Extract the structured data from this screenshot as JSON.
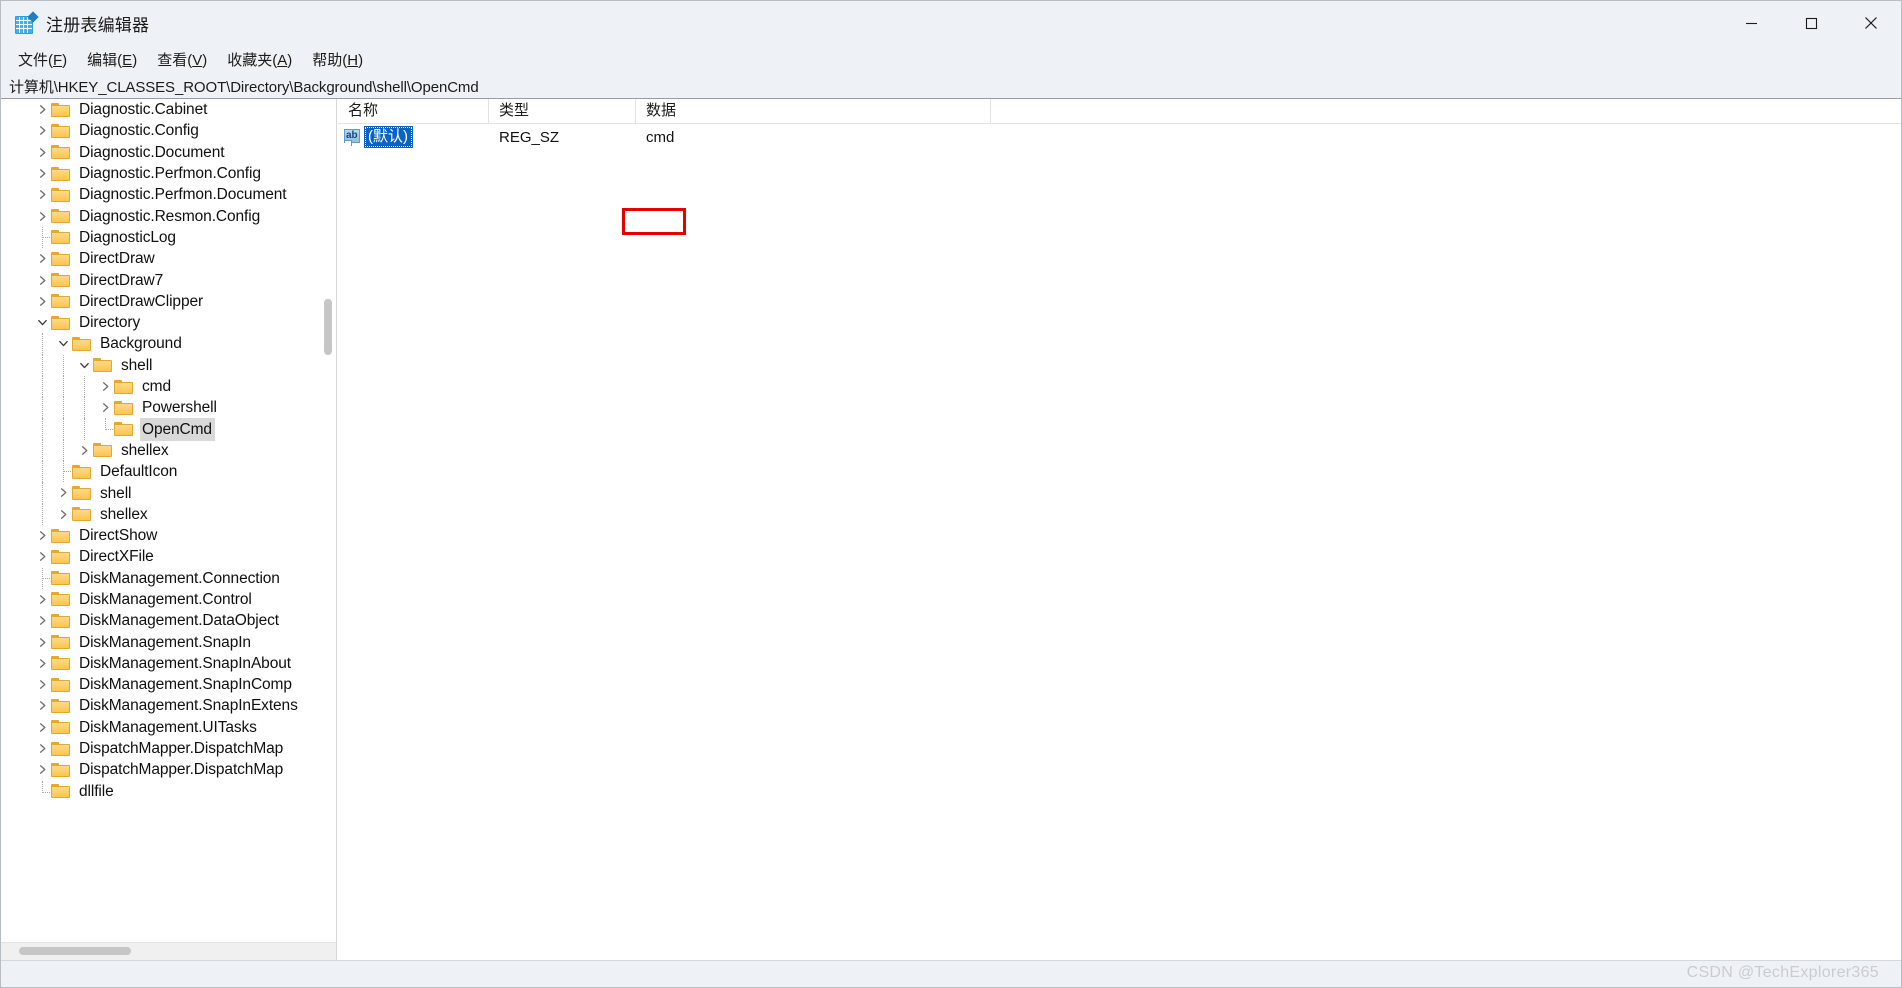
{
  "window": {
    "title": "注册表编辑器",
    "app_icon": "registry-editor-icon",
    "controls": {
      "minimize": "minimize-icon",
      "maximize": "maximize-icon",
      "close": "close-icon"
    }
  },
  "menubar": {
    "items": [
      {
        "label": "文件(F)",
        "text": "文件(",
        "mnemonic": "F",
        "tail": ")"
      },
      {
        "label": "编辑(E)",
        "text": "编辑(",
        "mnemonic": "E",
        "tail": ")"
      },
      {
        "label": "查看(V)",
        "text": "查看(",
        "mnemonic": "V",
        "tail": ")"
      },
      {
        "label": "收藏夹(A)",
        "text": "收藏夹(",
        "mnemonic": "A",
        "tail": ")"
      },
      {
        "label": "帮助(H)",
        "text": "帮助(",
        "mnemonic": "H",
        "tail": ")"
      }
    ]
  },
  "address": {
    "path": "计算机\\HKEY_CLASSES_ROOT\\Directory\\Background\\shell\\OpenCmd"
  },
  "tree": {
    "nodes": [
      {
        "label": "Diagnostic.Cabinet",
        "depth": 1,
        "twisty": "collapsed",
        "selected": false
      },
      {
        "label": "Diagnostic.Config",
        "depth": 1,
        "twisty": "collapsed",
        "selected": false
      },
      {
        "label": "Diagnostic.Document",
        "depth": 1,
        "twisty": "collapsed",
        "selected": false
      },
      {
        "label": "Diagnostic.Perfmon.Config",
        "depth": 1,
        "twisty": "collapsed",
        "selected": false
      },
      {
        "label": "Diagnostic.Perfmon.Document",
        "depth": 1,
        "twisty": "collapsed",
        "selected": false
      },
      {
        "label": "Diagnostic.Resmon.Config",
        "depth": 1,
        "twisty": "collapsed",
        "selected": false
      },
      {
        "label": "DiagnosticLog",
        "depth": 1,
        "twisty": "none",
        "selected": false
      },
      {
        "label": "DirectDraw",
        "depth": 1,
        "twisty": "collapsed",
        "selected": false
      },
      {
        "label": "DirectDraw7",
        "depth": 1,
        "twisty": "collapsed",
        "selected": false
      },
      {
        "label": "DirectDrawClipper",
        "depth": 1,
        "twisty": "collapsed",
        "selected": false
      },
      {
        "label": "Directory",
        "depth": 1,
        "twisty": "expanded",
        "selected": false
      },
      {
        "label": "Background",
        "depth": 2,
        "twisty": "expanded",
        "selected": false
      },
      {
        "label": "shell",
        "depth": 3,
        "twisty": "expanded",
        "selected": false
      },
      {
        "label": "cmd",
        "depth": 4,
        "twisty": "collapsed",
        "selected": false
      },
      {
        "label": "Powershell",
        "depth": 4,
        "twisty": "collapsed",
        "selected": false
      },
      {
        "label": "OpenCmd",
        "depth": 4,
        "twisty": "none",
        "selected": true
      },
      {
        "label": "shellex",
        "depth": 3,
        "twisty": "collapsed",
        "selected": false
      },
      {
        "label": "DefaultIcon",
        "depth": 2,
        "twisty": "none",
        "selected": false
      },
      {
        "label": "shell",
        "depth": 2,
        "twisty": "collapsed",
        "selected": false
      },
      {
        "label": "shellex",
        "depth": 2,
        "twisty": "collapsed",
        "selected": false
      },
      {
        "label": "DirectShow",
        "depth": 1,
        "twisty": "collapsed",
        "selected": false
      },
      {
        "label": "DirectXFile",
        "depth": 1,
        "twisty": "collapsed",
        "selected": false
      },
      {
        "label": "DiskManagement.Connection",
        "depth": 1,
        "twisty": "none",
        "selected": false
      },
      {
        "label": "DiskManagement.Control",
        "depth": 1,
        "twisty": "collapsed",
        "selected": false
      },
      {
        "label": "DiskManagement.DataObject",
        "depth": 1,
        "twisty": "collapsed",
        "selected": false
      },
      {
        "label": "DiskManagement.SnapIn",
        "depth": 1,
        "twisty": "collapsed",
        "selected": false
      },
      {
        "label": "DiskManagement.SnapInAbout",
        "depth": 1,
        "twisty": "collapsed",
        "selected": false
      },
      {
        "label": "DiskManagement.SnapInComp",
        "depth": 1,
        "twisty": "collapsed",
        "selected": false
      },
      {
        "label": "DiskManagement.SnapInExtens",
        "depth": 1,
        "twisty": "collapsed",
        "selected": false
      },
      {
        "label": "DiskManagement.UITasks",
        "depth": 1,
        "twisty": "collapsed",
        "selected": false
      },
      {
        "label": "DispatchMapper.DispatchMap",
        "depth": 1,
        "twisty": "collapsed",
        "selected": false
      },
      {
        "label": "DispatchMapper.DispatchMap",
        "depth": 1,
        "twisty": "collapsed",
        "selected": false
      },
      {
        "label": "dllfile",
        "depth": 1,
        "twisty": "none",
        "selected": false
      }
    ]
  },
  "values": {
    "columns": [
      "名称",
      "类型",
      "数据"
    ],
    "rows": [
      {
        "name": "(默认)",
        "type": "REG_SZ",
        "data": "cmd",
        "icon": "string-value-icon",
        "selected": true,
        "highlighted": true
      }
    ]
  },
  "annotation": {
    "highlight_color": "#e60000",
    "target": "cmd"
  },
  "watermark": {
    "text": "CSDN @TechExplorer365"
  }
}
